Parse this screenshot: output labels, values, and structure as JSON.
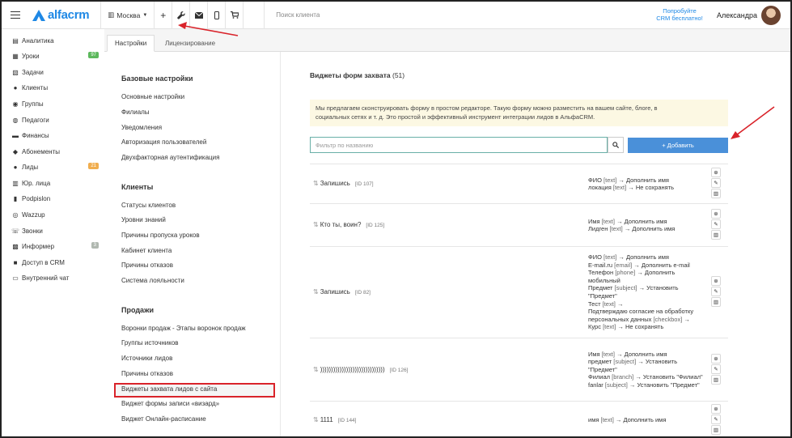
{
  "topbar": {
    "logo_text": "alfacrm",
    "city": "Москва",
    "search_placeholder": "Поиск клиента",
    "promo_line1": "Попробуйте",
    "promo_line2": "CRM бесплатно!",
    "user_name": "Александра",
    "brand_color": "#1e88e5"
  },
  "sidebar": {
    "items": [
      {
        "label": "Аналитика",
        "icon": "analytics-icon"
      },
      {
        "label": "Уроки",
        "icon": "calendar-icon",
        "badge": "97",
        "badge_color": "#5cb85c"
      },
      {
        "label": "Задачи",
        "icon": "tasks-icon"
      },
      {
        "label": "Клиенты",
        "icon": "user-icon"
      },
      {
        "label": "Группы",
        "icon": "users-icon"
      },
      {
        "label": "Педагоги",
        "icon": "teacher-icon"
      },
      {
        "label": "Финансы",
        "icon": "money-icon"
      },
      {
        "label": "Абонементы",
        "icon": "tag-icon"
      },
      {
        "label": "Лиды",
        "icon": "user-icon",
        "badge": "21",
        "badge_color": "#f0ad4e"
      },
      {
        "label": "Юр. лица",
        "icon": "building-icon"
      },
      {
        "label": "Podpislon",
        "icon": "document-icon"
      },
      {
        "label": "Wazzup",
        "icon": "whatsapp-icon"
      },
      {
        "label": "Звонки",
        "icon": "phone-icon"
      },
      {
        "label": "Информер",
        "icon": "informer-icon",
        "badge": "3",
        "badge_color": "#b0b8b0"
      },
      {
        "label": "Доступ в CRM",
        "icon": "lock-icon"
      },
      {
        "label": "Внутренний чат",
        "icon": "chat-icon"
      }
    ]
  },
  "tabs": [
    {
      "label": "Настройки"
    },
    {
      "label": "Лицензирование"
    }
  ],
  "settings": {
    "base_title": "Базовые настройки",
    "base_links": [
      "Основные настройки",
      "Филиалы",
      "Уведомления",
      "Авторизация пользователей",
      "Двухфакторная аутентификация"
    ],
    "clients_title": "Клиенты",
    "clients_links": [
      "Статусы клиентов",
      "Уровни знаний",
      "Причины пропуска уроков",
      "Кабинет клиента",
      "Причины отказов",
      "Система лояльности"
    ],
    "sales_title": "Продажи",
    "sales_links": [
      "Воронки продаж - Этапы воронок продаж",
      "Группы источников",
      "Источники лидов",
      "Причины отказов",
      "Виджеты захвата лидов с сайта",
      "Виджет формы записи «визард»",
      "Виджет Онлайн-расписание"
    ]
  },
  "main": {
    "title": "Виджеты форм захвата",
    "count": "(51)",
    "notice_line1": "Мы предлагаем сконструировать форму в простом редакторе. Такую форму можно разместить на вашем сайте, блоге, в",
    "notice_line2": "социальных сетях и т. д. Это простой и эффективный инструмент интеграции лидов в АльфаCRM.",
    "filter_placeholder": "Фильтр по названию",
    "add_label": "+ Добавить",
    "accent_color": "#4a90d9",
    "highlight_color": "#d9232a"
  },
  "widgets": [
    {
      "name": "Запишись",
      "id": "[ID 107]",
      "fields": [
        [
          "ФИО",
          "[text]",
          "→ Дополнить имя"
        ],
        [
          "локация",
          "[text]",
          "→ Не сохранять"
        ]
      ]
    },
    {
      "name": "Кто ты, воин?",
      "id": "[ID 125]",
      "fields": [
        [
          "Имя",
          "[text]",
          "→ Дополнить имя"
        ],
        [
          "Лидген",
          "[text]",
          "→ Дополнить имя"
        ]
      ]
    },
    {
      "name": "Запишись",
      "id": "[ID 82]",
      "fields": [
        [
          "ФИО",
          "[text]",
          "→ Дополнить имя"
        ],
        [
          "E-mail.ru",
          "[email]",
          "→ Дополнить e-mail"
        ],
        [
          "Телефон",
          "[phone]",
          "→ Дополнить мобильный"
        ],
        [
          "Предмет",
          "[subject]",
          "→ Установить \"Предмет\""
        ],
        [
          "Тест",
          "[text]",
          "→"
        ],
        [
          "Подтверждаю согласие на обработку персональных данных",
          "[checkbox]",
          "→"
        ],
        [
          "Курс",
          "[text]",
          "→ Не сохранять"
        ]
      ]
    },
    {
      "name": "))))))))))))))))))))))))))))))",
      "id": "[ID 126]",
      "fields": [
        [
          "Имя",
          "[text]",
          "→ Дополнить имя"
        ],
        [
          "предмет",
          "[subject]",
          "→ Установить \"Предмет\""
        ],
        [
          "Филиал",
          "[branch]",
          "→ Установить \"Филиал\""
        ],
        [
          "fanlar",
          "[subject]",
          "→ Установить \"Предмет\""
        ]
      ]
    },
    {
      "name": "1111",
      "id": "[ID 144]",
      "fields": [
        [
          "имя",
          "[text]",
          "→ Дополнить имя"
        ]
      ]
    }
  ]
}
